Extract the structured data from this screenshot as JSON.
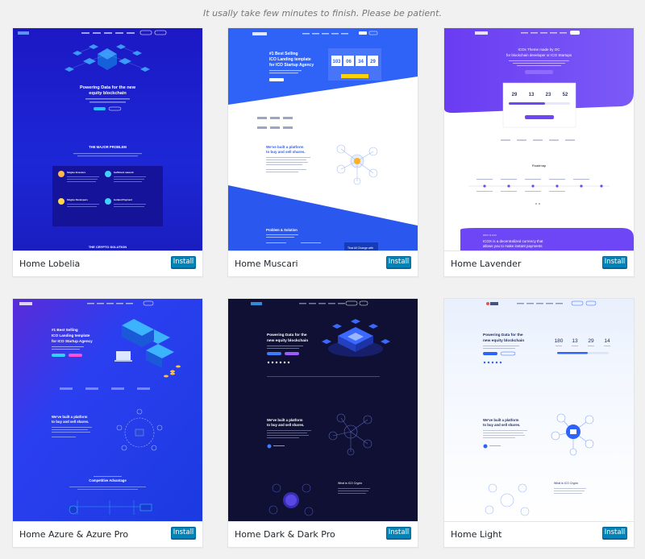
{
  "notice": "It usally take few minutes to finish. Please be patient.",
  "install_label": "Install",
  "cards": [
    {
      "name": "Home Lobelia",
      "hero_title_1": "Powering Data for the new",
      "hero_title_2": "equity blockchain",
      "section_heading": "THE MAJOR PROBLEM",
      "features": [
        "Singles Investors",
        "Inefficient network",
        "Singles Developers",
        "Isolated Payment"
      ],
      "bottom_heading": "THE CRYPTO SOLUTION"
    },
    {
      "name": "Home Muscari",
      "hero_title_1": "#1 Best Selling",
      "hero_title_2": "ICO Landing template",
      "hero_title_3": "for ICO Startup Agency",
      "countdown": [
        "103",
        "06",
        "34",
        "29"
      ],
      "section_title_1": "We've built a platform",
      "section_title_2": "to buy and sell shares.",
      "bottom_title": "Problem & Solution",
      "bottom_card": "That All Change with"
    },
    {
      "name": "Home Lavender",
      "hero_title_1": "ICOs Theme made by OC",
      "hero_title_2": "for blockchain developer or ICO Startups",
      "countdown": [
        "29",
        "13",
        "23",
        "52"
      ],
      "roadmap_title": "Roadmap",
      "bottom_text": "ICOX is a decentralized currency that allows you to make instant payments",
      "bottom_small": "WHAT IS ICOX"
    },
    {
      "name": "Home Azure & Azure Pro",
      "hero_title_1": "#1 Best Selling",
      "hero_title_2": "ICO Landing template",
      "hero_title_3": "for ICO Startup Agency",
      "section_title_1": "We've built a platform",
      "section_title_2": "to buy and sell shares.",
      "bottom_heading": "Competitive Advantage"
    },
    {
      "name": "Home Dark & Dark Pro",
      "hero_title_1": "Powering Data for the",
      "hero_title_2": "new equity blockchain",
      "section_title_1": "We've built a platform",
      "section_title_2": "to buy and sell shares.",
      "bottom_small": "What is ICO Crypto"
    },
    {
      "name": "Home Light",
      "hero_title_1": "Powering Data for the",
      "hero_title_2": "new equity blockchain",
      "countdown": [
        "180",
        "13",
        "29",
        "14"
      ],
      "section_title_1": "We've built a platform",
      "section_title_2": "to buy and sell shares.",
      "bottom_small": "What is ICO Crypto"
    }
  ],
  "colors": {
    "install_bg": "#0085ba",
    "lobelia_bg": "#1b1fc9",
    "muscari_blue": "#2b5cf6",
    "lavender_purple": "#6c46f5",
    "azure_bg": "#2249e6",
    "dark_bg": "#0f1034",
    "light_bg": "#eef3fd"
  }
}
